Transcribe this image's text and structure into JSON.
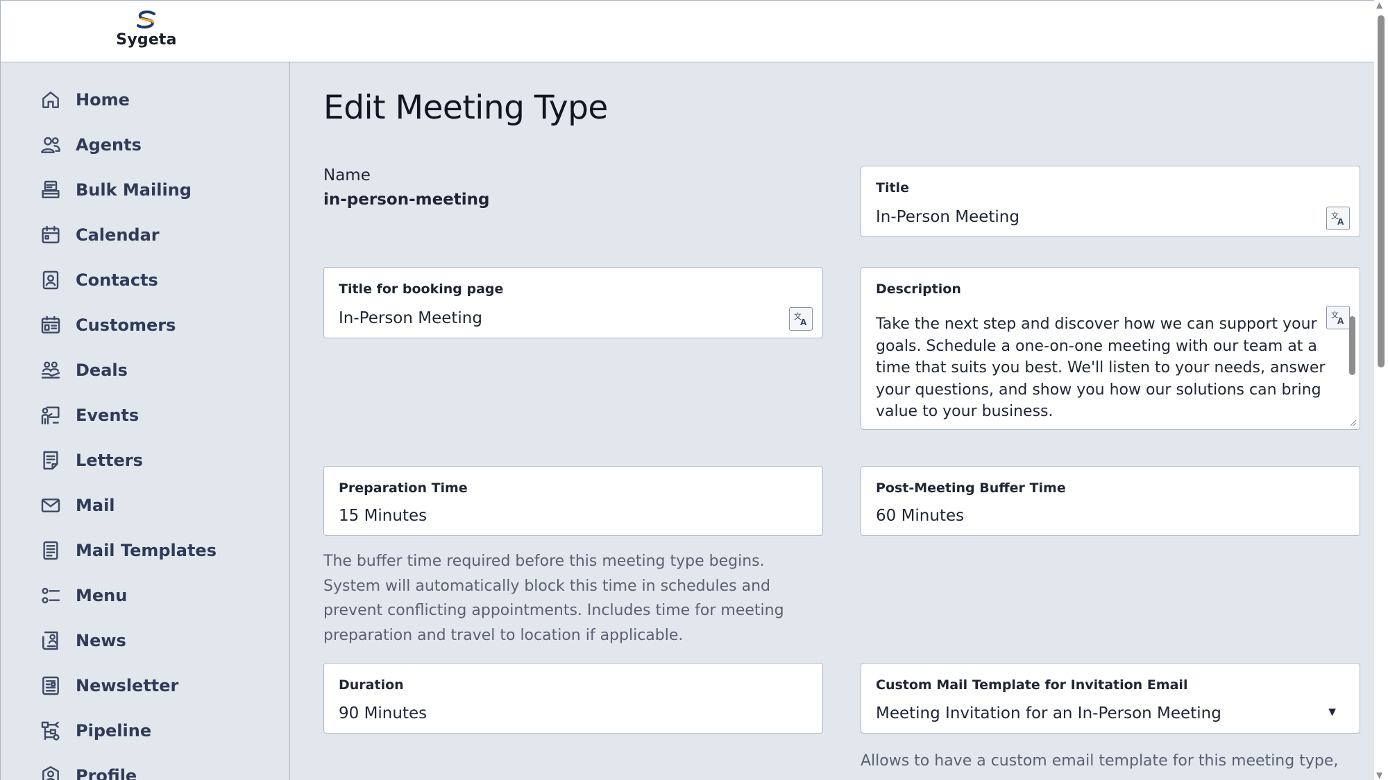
{
  "brand": {
    "name": "Sygeta"
  },
  "sidebar": {
    "items": [
      {
        "label": "Home",
        "icon": "home-icon"
      },
      {
        "label": "Agents",
        "icon": "agents-icon"
      },
      {
        "label": "Bulk Mailing",
        "icon": "bulk-mailing-icon"
      },
      {
        "label": "Calendar",
        "icon": "calendar-icon"
      },
      {
        "label": "Contacts",
        "icon": "contacts-icon"
      },
      {
        "label": "Customers",
        "icon": "customers-icon"
      },
      {
        "label": "Deals",
        "icon": "deals-icon"
      },
      {
        "label": "Events",
        "icon": "events-icon"
      },
      {
        "label": "Letters",
        "icon": "letters-icon"
      },
      {
        "label": "Mail",
        "icon": "mail-icon"
      },
      {
        "label": "Mail Templates",
        "icon": "mail-templates-icon"
      },
      {
        "label": "Menu",
        "icon": "menu-icon"
      },
      {
        "label": "News",
        "icon": "news-icon"
      },
      {
        "label": "Newsletter",
        "icon": "newsletter-icon"
      },
      {
        "label": "Pipeline",
        "icon": "pipeline-icon"
      },
      {
        "label": "Profile",
        "icon": "profile-icon"
      }
    ]
  },
  "main": {
    "title": "Edit Meeting Type",
    "name_label": "Name",
    "name_value": "in-person-meeting",
    "title_field": {
      "label": "Title",
      "value": "In-Person Meeting"
    },
    "booking_title_field": {
      "label": "Title for booking page",
      "value": "In-Person Meeting"
    },
    "description_field": {
      "label": "Description",
      "lines": [
        "Take the next step and discover how we can support your",
        "goals. Schedule a one-on-one meeting with our team at a",
        "time that suits you best. We'll listen to your needs, answer",
        "your questions, and show you how our solutions can bring",
        "value to your business."
      ]
    },
    "preparation_time": {
      "label": "Preparation Time",
      "value": "15 Minutes",
      "help_lines": [
        "The buffer time required before this meeting type begins.",
        "System will automatically block this time in schedules and",
        "prevent conflicting appointments. Includes time for meeting",
        "preparation and travel to location if applicable."
      ]
    },
    "post_buffer_time": {
      "label": "Post-Meeting Buffer Time",
      "value": "60 Minutes"
    },
    "duration": {
      "label": "Duration",
      "value": "90 Minutes"
    },
    "custom_mail_template": {
      "label": "Custom Mail Template for Invitation Email",
      "value": "Meeting Invitation for an In-Person Meeting",
      "help": "Allows to have a custom email template for this meeting type,"
    }
  },
  "colors": {
    "background": "#e2e7ee",
    "border": "#aeb8c8",
    "text": "#1f2533",
    "nav_text": "#2f3b57",
    "help_text": "#5a6272"
  }
}
